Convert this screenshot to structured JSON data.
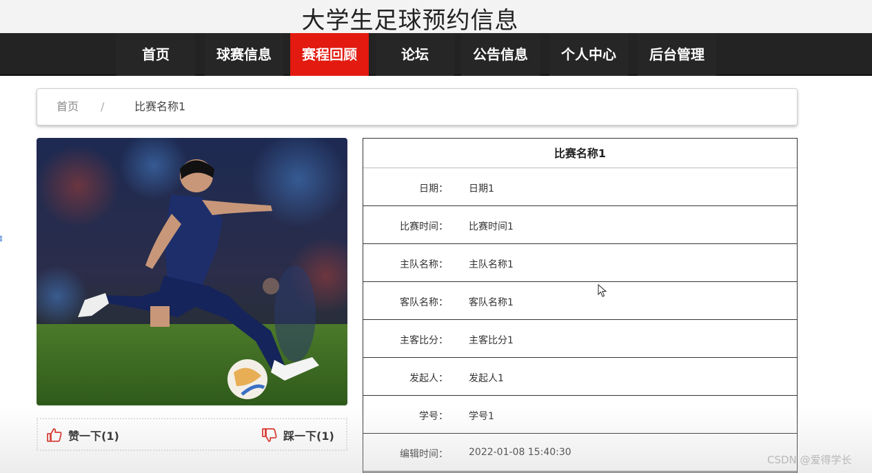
{
  "site": {
    "title": "大学生足球预约信息"
  },
  "nav": {
    "items": [
      {
        "label": "首页"
      },
      {
        "label": "球赛信息"
      },
      {
        "label": "赛程回顾",
        "active": true
      },
      {
        "label": "论坛"
      },
      {
        "label": "公告信息"
      },
      {
        "label": "个人中心"
      },
      {
        "label": "后台管理"
      }
    ],
    "active_color": "#e21a0f",
    "bar_color": "#232323"
  },
  "breadcrumb": {
    "home": "首页",
    "separator": "/",
    "current": "比赛名称1"
  },
  "photo": {
    "subject": "soccer-player-kicking-ball"
  },
  "votes": {
    "like_label": "赞一下(1)",
    "dislike_label": "踩一下(1)",
    "icon_color": "#d9261c"
  },
  "details": {
    "title": "比赛名称1",
    "rows": [
      {
        "label": "日期：",
        "value": "日期1"
      },
      {
        "label": "比赛时间：",
        "value": "比赛时间1"
      },
      {
        "label": "主队名称：",
        "value": "主队名称1"
      },
      {
        "label": "客队名称：",
        "value": "客队名称1"
      },
      {
        "label": "主客比分：",
        "value": "主客比分1"
      },
      {
        "label": "发起人：",
        "value": "发起人1"
      },
      {
        "label": "学号：",
        "value": "学号1"
      },
      {
        "label": "编辑时间：",
        "value": "2022-01-08 15:40:30"
      }
    ]
  },
  "watermark": "CSDN @爱得学长"
}
